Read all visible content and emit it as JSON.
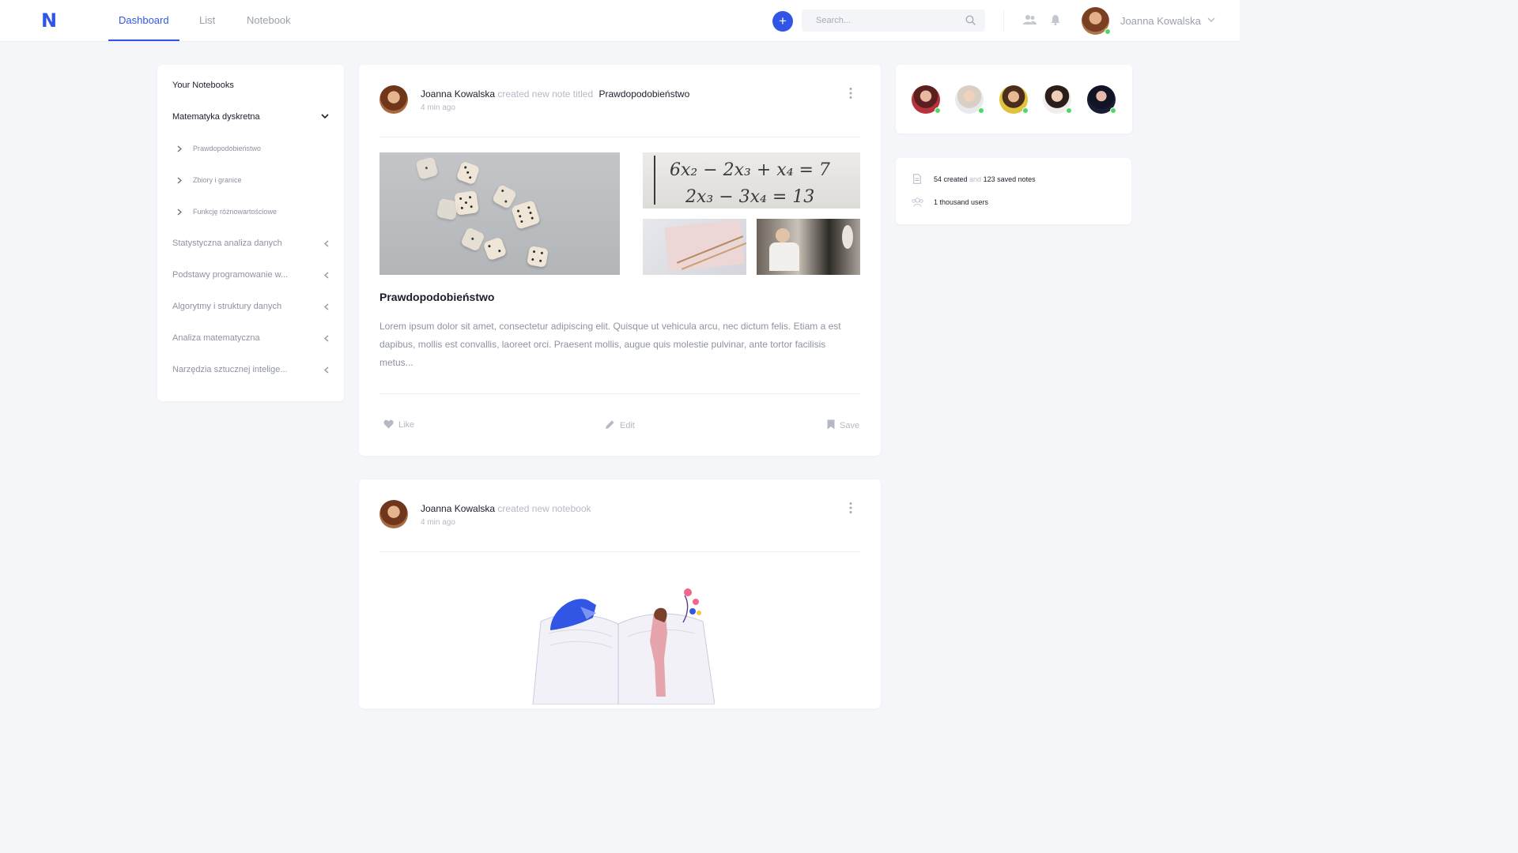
{
  "app": {
    "logo": "N"
  },
  "nav": {
    "tabs": [
      {
        "label": "Dashboard",
        "active": true
      },
      {
        "label": "List",
        "active": false
      },
      {
        "label": "Notebook",
        "active": false
      }
    ],
    "add_label": "+",
    "search_placeholder": "Search...",
    "user_name": "Joanna Kowalska",
    "icons": [
      "users-icon",
      "bell-icon"
    ]
  },
  "sidebar": {
    "title": "Your Notebooks",
    "notebooks": [
      {
        "label": "Matematyka dyskretna",
        "expanded": true,
        "children": [
          "Prawdopodobieństwo",
          "Zbiory i granice",
          "Funkcję różnowartościowe"
        ]
      },
      {
        "label": "Statystyczna analiza danych",
        "expanded": false
      },
      {
        "label": "Podstawy programowanie w...",
        "expanded": false
      },
      {
        "label": "Algorytmy i struktury danych",
        "expanded": false
      },
      {
        "label": "Analiza matematyczna",
        "expanded": false
      },
      {
        "label": "Narzędzia sztucznej intelige...",
        "expanded": false
      }
    ]
  },
  "feed": {
    "post1": {
      "author": "Joanna Kowalska",
      "action": "created new note titled",
      "note_title": "Prawdopodobieństwo",
      "time": "4 min ago",
      "title": "Prawdopodobieństwo",
      "body": "Lorem ipsum dolor sit amet, consectetur adipiscing elit. Quisque ut vehicula arcu, nec dictum felis. Etiam a est dapibus, mollis est convallis, laoreet orci. Praesent mollis, augue quis molestie pulvinar, ante tortor facilisis metus...",
      "equation_line1": "6x₂ − 2x₃ + x₄ = 7",
      "equation_line2": "2x₃ − 3x₄ = 13",
      "actions": {
        "like": "Like",
        "edit": "Edit",
        "save": "Save"
      }
    },
    "post2": {
      "author": "Joanna Kowalska",
      "action": "created new notebook",
      "time": "4 min ago"
    }
  },
  "friends": {
    "online_color": "#4cd964",
    "count": 5
  },
  "stats": {
    "created_count": "54 created",
    "and_word": "and",
    "saved_count": "123 saved notes",
    "users": "1 thousand users"
  },
  "colors": {
    "accent": "#3156e6",
    "muted": "#8d93a0",
    "background": "#f5f6fa"
  }
}
